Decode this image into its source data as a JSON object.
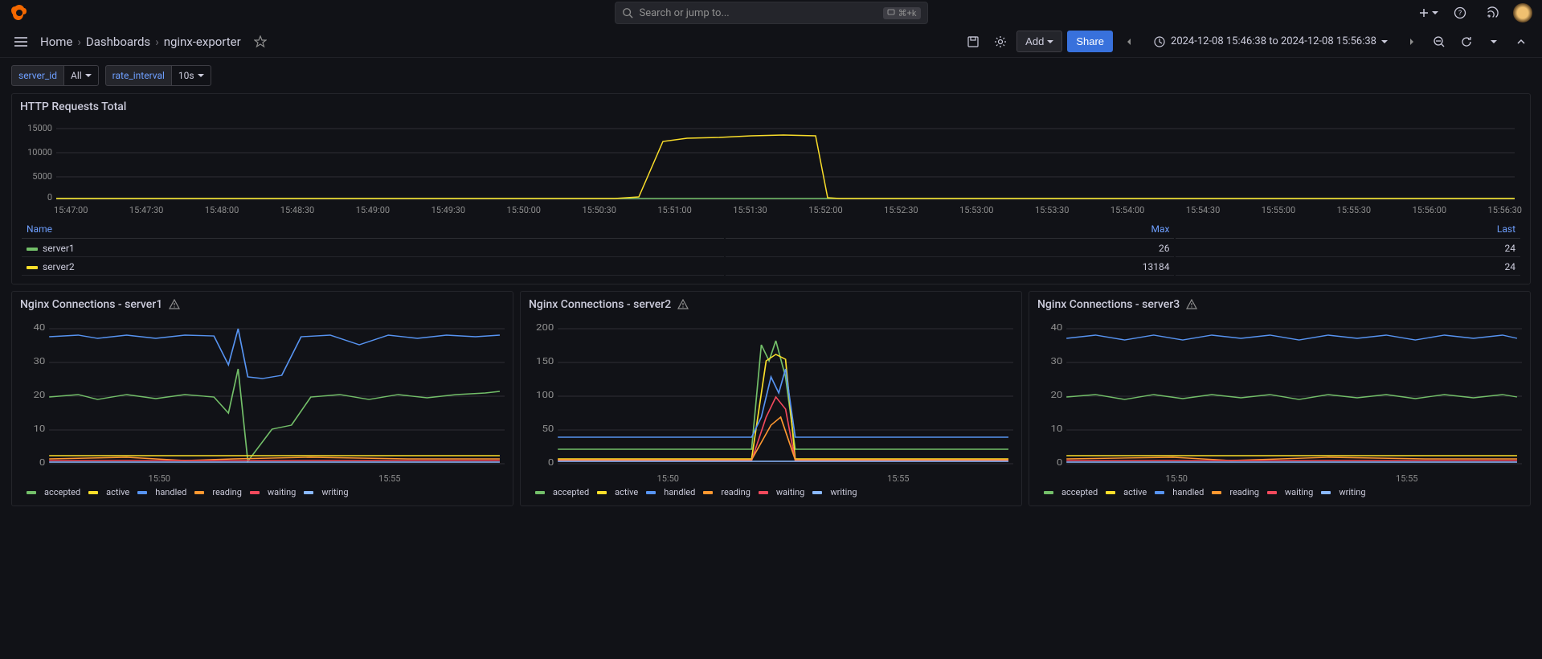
{
  "search": {
    "placeholder": "Search or jump to...",
    "kbd": "⌘+k"
  },
  "breadcrumb": {
    "home": "Home",
    "dashboards": "Dashboards",
    "current": "nginx-exporter"
  },
  "toolbar": {
    "add": "Add",
    "share": "Share",
    "timerange": "2024-12-08 15:46:38 to 2024-12-08 15:56:38"
  },
  "vars": {
    "server_id_label": "server_id",
    "server_id_value": "All",
    "rate_label": "rate_interval",
    "rate_value": "10s"
  },
  "panel1": {
    "title": "HTTP Requests Total",
    "legend_headers": {
      "name": "Name",
      "max": "Max",
      "last": "Last"
    },
    "series": [
      {
        "name": "server1",
        "color": "#73bf69",
        "max": "26",
        "last": "24"
      },
      {
        "name": "server2",
        "color": "#fade2a",
        "max": "13184",
        "last": "24"
      }
    ],
    "xticks": [
      "15:47:00",
      "15:47:30",
      "15:48:00",
      "15:48:30",
      "15:49:00",
      "15:49:30",
      "15:50:00",
      "15:50:30",
      "15:51:00",
      "15:51:30",
      "15:52:00",
      "15:52:30",
      "15:53:00",
      "15:53:30",
      "15:54:00",
      "15:54:30",
      "15:55:00",
      "15:55:30",
      "15:56:00",
      "15:56:30"
    ]
  },
  "conn_panels": [
    {
      "title": "Nginx Connections - server1",
      "ymax": 40
    },
    {
      "title": "Nginx Connections - server2",
      "ymax": 200
    },
    {
      "title": "Nginx Connections - server3",
      "ymax": 40
    }
  ],
  "conn_legend": [
    {
      "name": "accepted",
      "color": "#73bf69"
    },
    {
      "name": "active",
      "color": "#fade2a"
    },
    {
      "name": "handled",
      "color": "#5794f2"
    },
    {
      "name": "reading",
      "color": "#ff9830"
    },
    {
      "name": "waiting",
      "color": "#f2495c"
    },
    {
      "name": "writing",
      "color": "#8ab8ff"
    }
  ],
  "conn_xticks": [
    "15:50",
    "15:55"
  ],
  "chart_data": [
    {
      "type": "line",
      "title": "HTTP Requests Total",
      "xlabel": "",
      "ylabel": "",
      "ylim": [
        0,
        15000
      ],
      "x": [
        "15:47:00",
        "15:47:30",
        "15:48:00",
        "15:48:30",
        "15:49:00",
        "15:49:30",
        "15:50:00",
        "15:50:30",
        "15:51:00",
        "15:51:30",
        "15:52:00",
        "15:52:30",
        "15:53:00",
        "15:53:30",
        "15:54:00",
        "15:54:30",
        "15:55:00",
        "15:55:30",
        "15:56:00",
        "15:56:30"
      ],
      "series": [
        {
          "name": "server1",
          "values": [
            24,
            24,
            24,
            24,
            24,
            24,
            24,
            24,
            24,
            24,
            24,
            24,
            24,
            24,
            24,
            24,
            24,
            24,
            24,
            24
          ]
        },
        {
          "name": "server2",
          "values": [
            24,
            24,
            24,
            24,
            24,
            24,
            24,
            500,
            11800,
            12800,
            12000,
            200,
            24,
            24,
            24,
            24,
            24,
            24,
            24,
            24
          ]
        }
      ]
    },
    {
      "type": "line",
      "title": "Nginx Connections - server1",
      "ylim": [
        0,
        40
      ],
      "x_range": [
        "15:47",
        "15:57"
      ],
      "series": [
        {
          "name": "accepted",
          "baseline": 18,
          "spikes_to": 22,
          "dip_to": 2,
          "dip_at": "15:50",
          "recover_to": 18
        },
        {
          "name": "active",
          "baseline": 3,
          "spikes_to": 5
        },
        {
          "name": "handled",
          "baseline": 36,
          "spikes_to": 40,
          "dip_to": 22,
          "dip_at": "15:50",
          "recover_to": 36
        },
        {
          "name": "reading",
          "baseline": 2
        },
        {
          "name": "waiting",
          "baseline": 2
        },
        {
          "name": "writing",
          "baseline": 2
        }
      ]
    },
    {
      "type": "line",
      "title": "Nginx Connections - server2",
      "ylim": [
        0,
        200
      ],
      "x_range": [
        "15:47",
        "15:57"
      ],
      "series": [
        {
          "name": "accepted",
          "baseline": 18,
          "spike_to": 190,
          "spike_at": "15:51"
        },
        {
          "name": "active",
          "baseline": 5,
          "spike_to": 160,
          "spike_at": "15:51"
        },
        {
          "name": "handled",
          "baseline": 38,
          "spike_to": 110,
          "spike_at": "15:51"
        },
        {
          "name": "reading",
          "baseline": 4,
          "spike_to": 60,
          "spike_at": "15:51"
        },
        {
          "name": "waiting",
          "baseline": 4,
          "spike_to": 90,
          "spike_at": "15:51"
        },
        {
          "name": "writing",
          "baseline": 4,
          "spike_to": 70,
          "spike_at": "15:51"
        }
      ]
    },
    {
      "type": "line",
      "title": "Nginx Connections - server3",
      "ylim": [
        0,
        40
      ],
      "x_range": [
        "15:47",
        "15:57"
      ],
      "series": [
        {
          "name": "accepted",
          "baseline": 18,
          "spikes_to": 20
        },
        {
          "name": "active",
          "baseline": 3
        },
        {
          "name": "handled",
          "baseline": 36,
          "spikes_to": 38
        },
        {
          "name": "reading",
          "baseline": 2
        },
        {
          "name": "waiting",
          "baseline": 2
        },
        {
          "name": "writing",
          "baseline": 2
        }
      ]
    }
  ]
}
